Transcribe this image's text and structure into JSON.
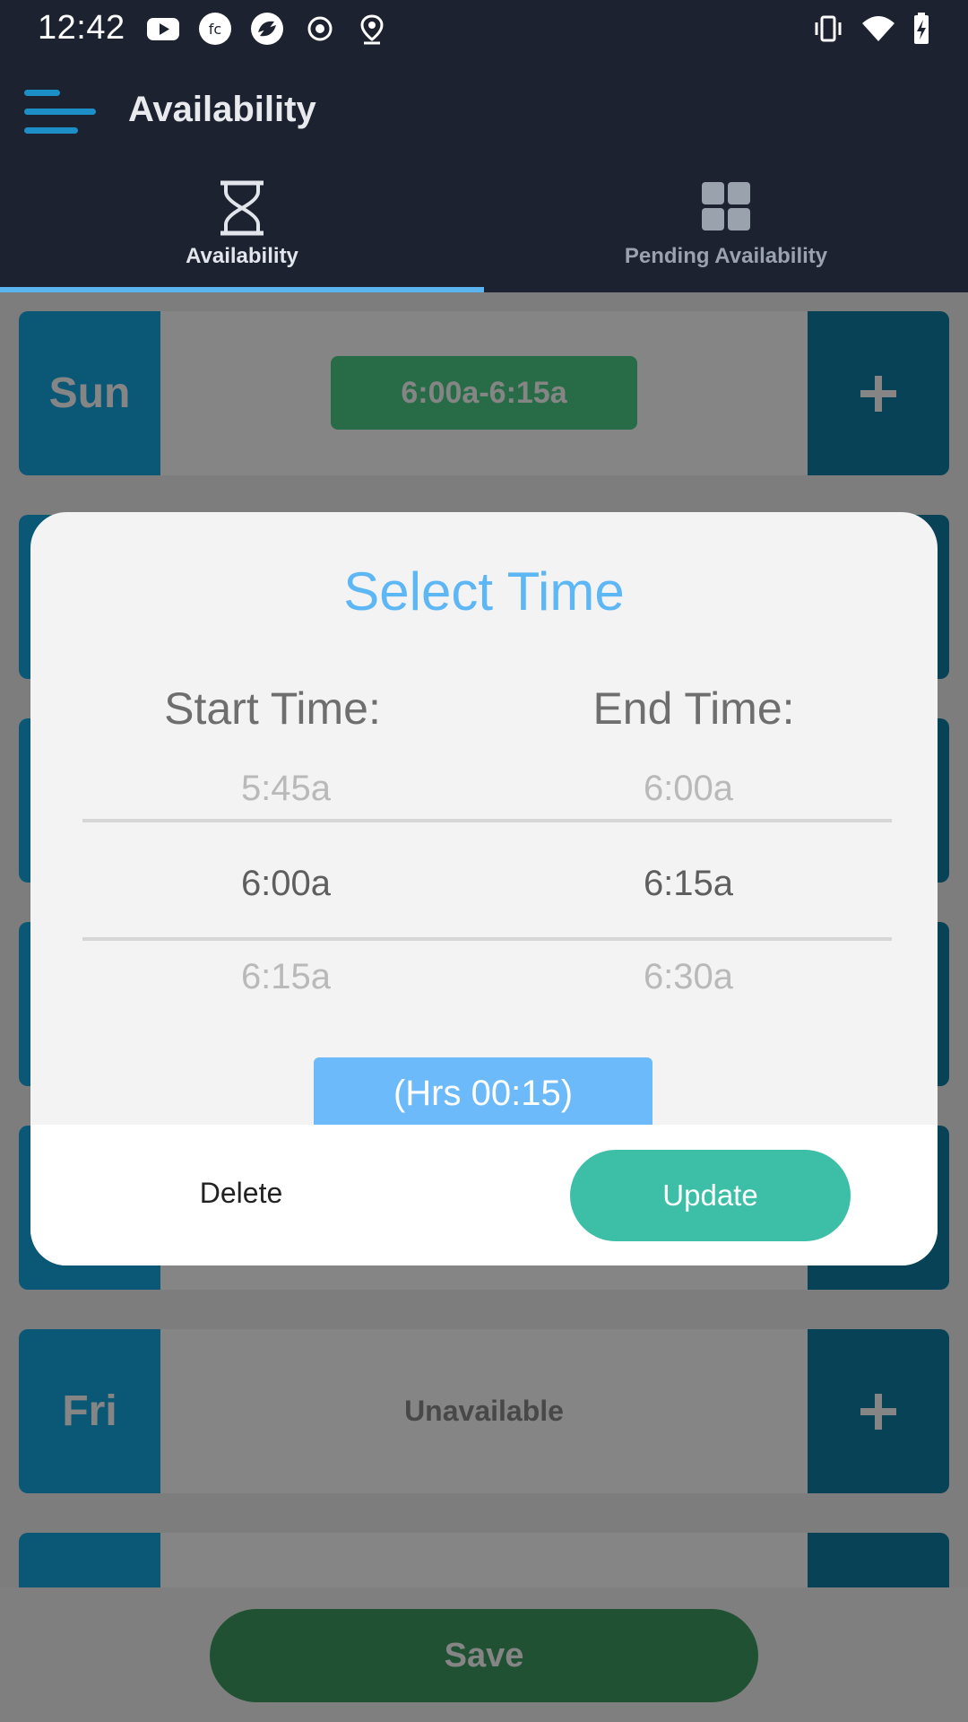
{
  "status_bar": {
    "time": "12:42",
    "left_icons": [
      "youtube-icon",
      "fc-app-icon",
      "camera-shutter-icon",
      "record-icon",
      "location-pin-icon"
    ],
    "right_icons": [
      "vibrate-icon",
      "wifi-icon",
      "battery-charging-icon"
    ]
  },
  "app_bar": {
    "title": "Availability",
    "menu_icon": "hamburger-menu-icon"
  },
  "tabs": [
    {
      "label": "Availability",
      "icon": "hourglass-icon",
      "selected": true
    },
    {
      "label": "Pending Availability",
      "icon": "grid-icon",
      "selected": false
    }
  ],
  "days": [
    {
      "label": "Sun",
      "slot": "6:00a-6:15a"
    },
    {
      "label": "",
      "slot": ""
    },
    {
      "label": "",
      "slot": ""
    },
    {
      "label": "",
      "slot": ""
    },
    {
      "label": "",
      "slot": ""
    },
    {
      "label": "Fri",
      "status": "Unavailable"
    },
    {
      "label": "",
      "slot": ""
    }
  ],
  "save_button": "Save",
  "dialog": {
    "title": "Select Time",
    "start_header": "Start Time:",
    "end_header": "End Time:",
    "start_values": [
      "5:45a",
      "6:00a",
      "6:15a"
    ],
    "end_values": [
      "6:00a",
      "6:15a",
      "6:30a"
    ],
    "duration": "(Hrs 00:15)",
    "delete_label": "Delete",
    "update_label": "Update"
  },
  "colors": {
    "header_bg": "#1c2230",
    "day_tile": "#16a9e3",
    "add_tile": "#0e7fa6",
    "slot_chip": "#4cd087",
    "accent_blue": "#5eb7f5",
    "update_button": "#3cbfa6",
    "save_button": "#3f9c62"
  }
}
